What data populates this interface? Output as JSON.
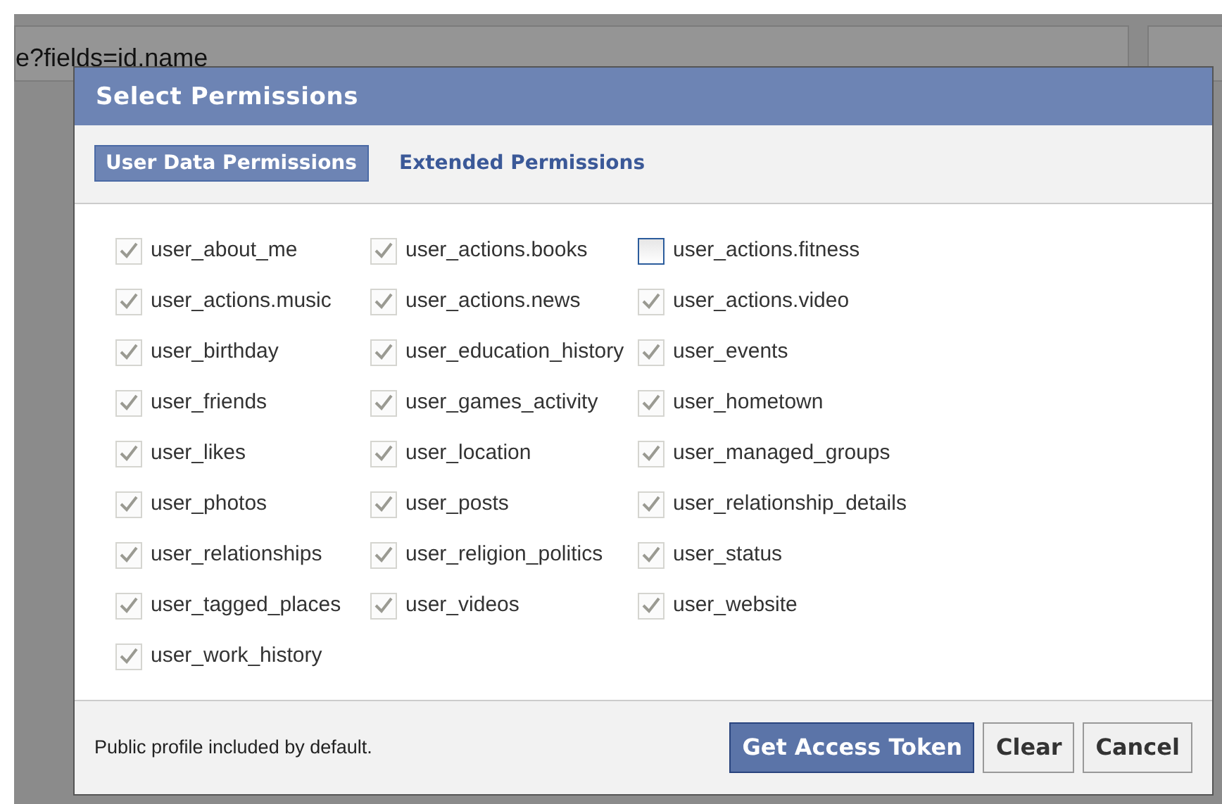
{
  "background": {
    "url_field": "e?fields=id,name"
  },
  "dialog": {
    "title": "Select Permissions",
    "tabs": [
      {
        "label": "User Data Permissions",
        "selected": true
      },
      {
        "label": "Extended Permissions",
        "selected": false
      }
    ],
    "permissions": [
      {
        "label": "user_about_me",
        "checked": true,
        "disabled": true
      },
      {
        "label": "user_actions.books",
        "checked": true,
        "disabled": true
      },
      {
        "label": "user_actions.fitness",
        "checked": false,
        "disabled": false
      },
      {
        "label": "user_actions.music",
        "checked": true,
        "disabled": true
      },
      {
        "label": "user_actions.news",
        "checked": true,
        "disabled": true
      },
      {
        "label": "user_actions.video",
        "checked": true,
        "disabled": true
      },
      {
        "label": "user_birthday",
        "checked": true,
        "disabled": true
      },
      {
        "label": "user_education_history",
        "checked": true,
        "disabled": true
      },
      {
        "label": "user_events",
        "checked": true,
        "disabled": true
      },
      {
        "label": "user_friends",
        "checked": true,
        "disabled": true
      },
      {
        "label": "user_games_activity",
        "checked": true,
        "disabled": true
      },
      {
        "label": "user_hometown",
        "checked": true,
        "disabled": true
      },
      {
        "label": "user_likes",
        "checked": true,
        "disabled": true
      },
      {
        "label": "user_location",
        "checked": true,
        "disabled": true
      },
      {
        "label": "user_managed_groups",
        "checked": true,
        "disabled": true
      },
      {
        "label": "user_photos",
        "checked": true,
        "disabled": true
      },
      {
        "label": "user_posts",
        "checked": true,
        "disabled": true
      },
      {
        "label": "user_relationship_details",
        "checked": true,
        "disabled": true
      },
      {
        "label": "user_relationships",
        "checked": true,
        "disabled": true
      },
      {
        "label": "user_religion_politics",
        "checked": true,
        "disabled": true
      },
      {
        "label": "user_status",
        "checked": true,
        "disabled": true
      },
      {
        "label": "user_tagged_places",
        "checked": true,
        "disabled": true
      },
      {
        "label": "user_videos",
        "checked": true,
        "disabled": true
      },
      {
        "label": "user_website",
        "checked": true,
        "disabled": true
      },
      {
        "label": "user_work_history",
        "checked": true,
        "disabled": true
      }
    ],
    "footer_note": "Public profile included by default.",
    "buttons": [
      {
        "label": "Get Access Token",
        "kind": "primary"
      },
      {
        "label": "Clear",
        "kind": "secondary"
      },
      {
        "label": "Cancel",
        "kind": "secondary"
      }
    ]
  }
}
